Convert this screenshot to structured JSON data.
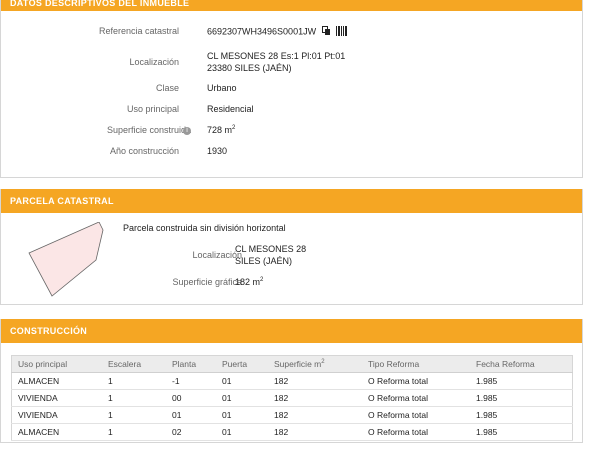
{
  "panel1": {
    "header": "DATOS DESCRIPTIVOS DEL INMUEBLE",
    "rows": [
      {
        "label": "Referencia catastral",
        "value": "6692307WH3496S0001JW"
      },
      {
        "label": "Localización",
        "value": "CL MESONES 28 Es:1 Pl:01 Pt:01",
        "value2": "23380 SILES (JAÉN)"
      },
      {
        "label": "Clase",
        "value": "Urbano"
      },
      {
        "label": "Uso principal",
        "value": "Residencial"
      },
      {
        "label": "Superficie construida",
        "value": "728 m"
      },
      {
        "label": "Año construcción",
        "value": "1930"
      }
    ]
  },
  "panel2": {
    "header": "PARCELA CATASTRAL",
    "title": "Parcela construida sin división horizontal",
    "loc_label": "Localización",
    "loc_value1": "CL MESONES 28",
    "loc_value2": "SILES (JAÉN)",
    "surf_label": "Superficie gráfica",
    "surf_value": "182 m"
  },
  "panel3": {
    "header": "CONSTRUCCIÓN",
    "columns": [
      "Uso principal",
      "Escalera",
      "Planta",
      "Puerta",
      "Superficie m",
      "Tipo Reforma",
      "Fecha Reforma"
    ],
    "rows": [
      [
        "ALMACEN",
        "1",
        "-1",
        "01",
        "182",
        "O Reforma total",
        "1.985"
      ],
      [
        "VIVIENDA",
        "1",
        "00",
        "01",
        "182",
        "O Reforma total",
        "1.985"
      ],
      [
        "VIVIENDA",
        "1",
        "01",
        "01",
        "182",
        "O Reforma total",
        "1.985"
      ],
      [
        "ALMACEN",
        "1",
        "02",
        "01",
        "182",
        "O Reforma total",
        "1.985"
      ]
    ]
  },
  "colors": {
    "accent": "#f5a623",
    "parcel_fill": "#fbe6e6"
  },
  "icons": {
    "copy": "copy-icon",
    "barcode": "barcode-icon",
    "info": "info-icon"
  }
}
